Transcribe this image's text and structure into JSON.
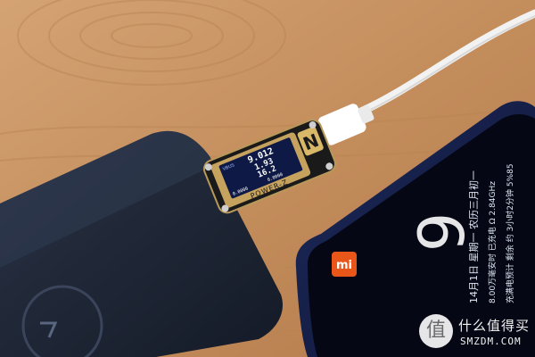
{
  "meter": {
    "brand": "POWER-Z",
    "logo_letter": "N",
    "readings": [
      "9.012",
      "1.93",
      "16.2",
      "0.0000",
      "0.0000"
    ],
    "units": [
      "V",
      "A",
      "W",
      "mAh",
      "Wh"
    ],
    "tag": "VBUS"
  },
  "phone": {
    "mi_logo": "mi",
    "clock_digit": "9",
    "text_lines": [
      "14月1日 星期一 农历三月初一",
      "8.00万毫安时 已充电 Ω 2.84GHz",
      "充满电预计 剩余 约 3小时2分钟 5%85"
    ]
  },
  "watermark": {
    "logo_glyph": "值",
    "cn": "什么值得买",
    "en": "SMZDM.COM"
  }
}
